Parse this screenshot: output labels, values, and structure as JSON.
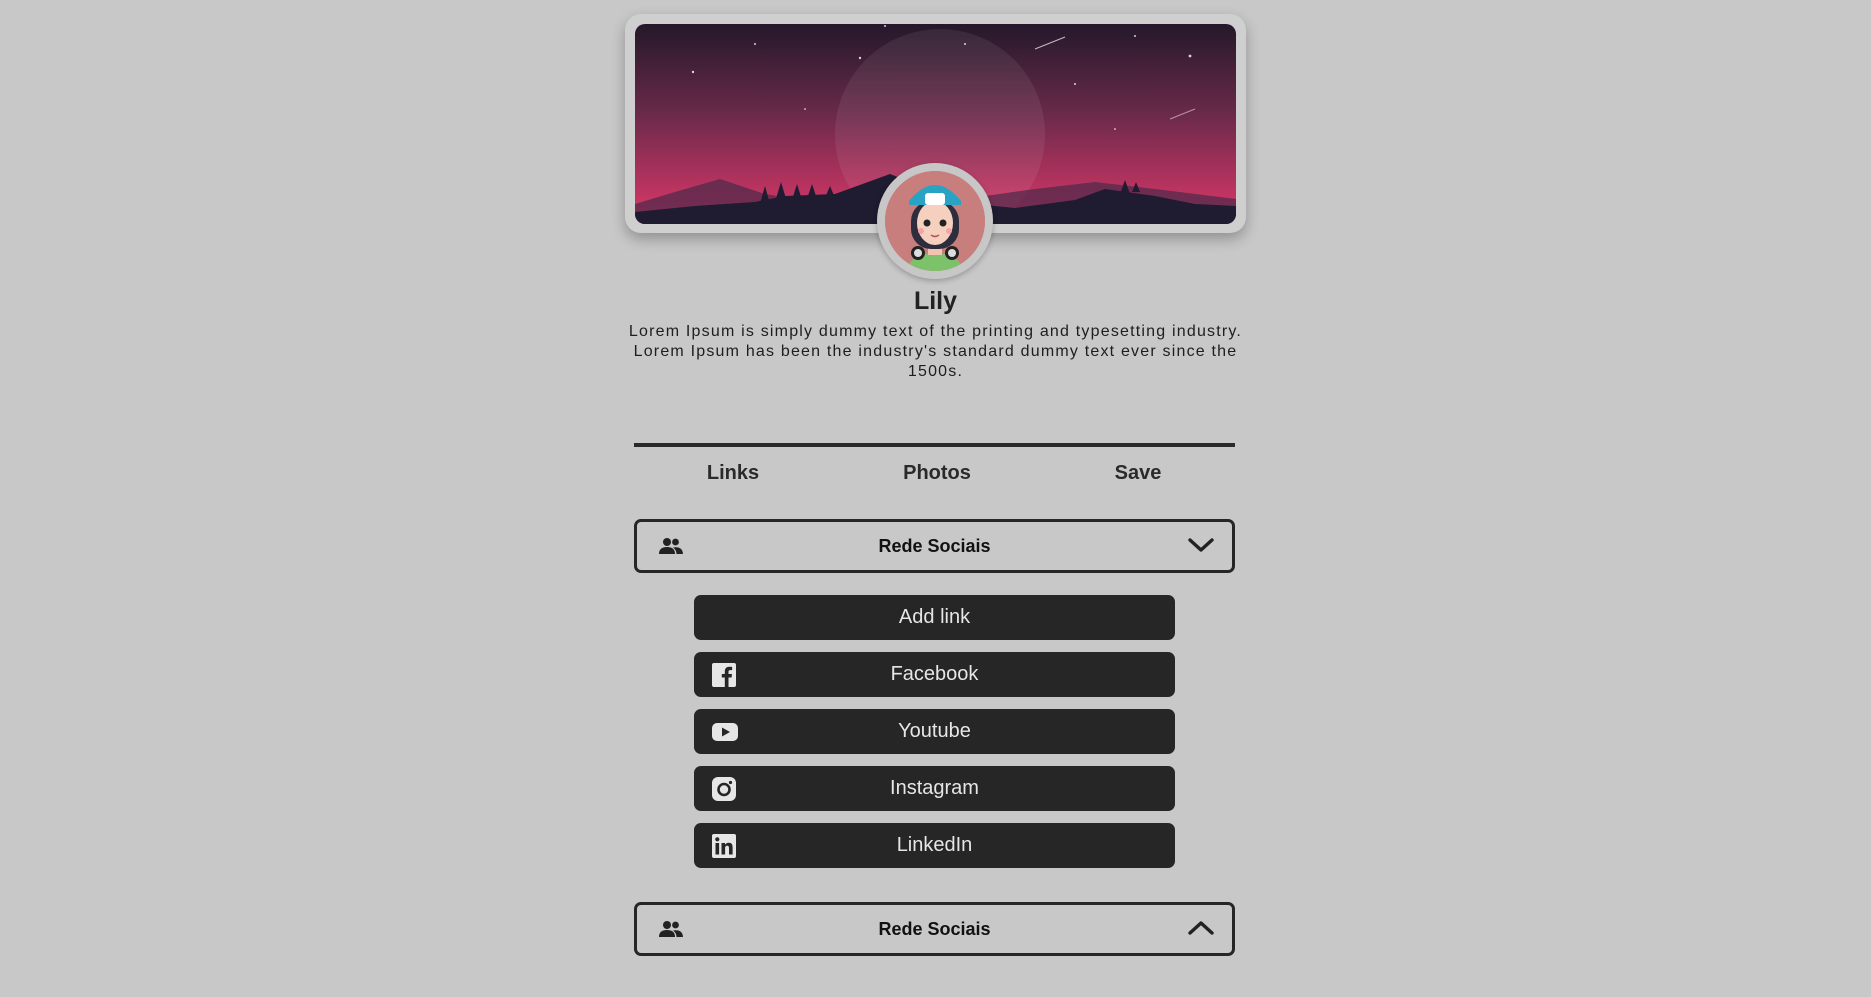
{
  "profile": {
    "name": "Lily",
    "bio": "Lorem Ipsum is simply dummy text of the printing and typesetting industry. Lorem Ipsum has been the industry's standard dummy text ever since the 1500s."
  },
  "tabs": [
    {
      "label": "Links"
    },
    {
      "label": "Photos"
    },
    {
      "label": "Save"
    }
  ],
  "sections": [
    {
      "title": "Rede Sociais",
      "icon": "people-icon",
      "state": "expanded",
      "chevron": "chevron-down-icon"
    },
    {
      "title": "Rede Sociais",
      "icon": "people-icon",
      "state": "collapsed",
      "chevron": "chevron-up-icon"
    }
  ],
  "links": [
    {
      "label": "Add link",
      "icon": ""
    },
    {
      "label": "Facebook",
      "icon": "facebook-icon"
    },
    {
      "label": "Youtube",
      "icon": "youtube-icon"
    },
    {
      "label": "Instagram",
      "icon": "instagram-icon"
    },
    {
      "label": "LinkedIn",
      "icon": "linkedin-icon"
    }
  ],
  "colors": {
    "background": "#c8c8c8",
    "button": "#262626",
    "button_text": "#e6e6e6",
    "banner_sky_top": "#2a1a2e",
    "banner_sky_bottom": "#e0386a"
  }
}
